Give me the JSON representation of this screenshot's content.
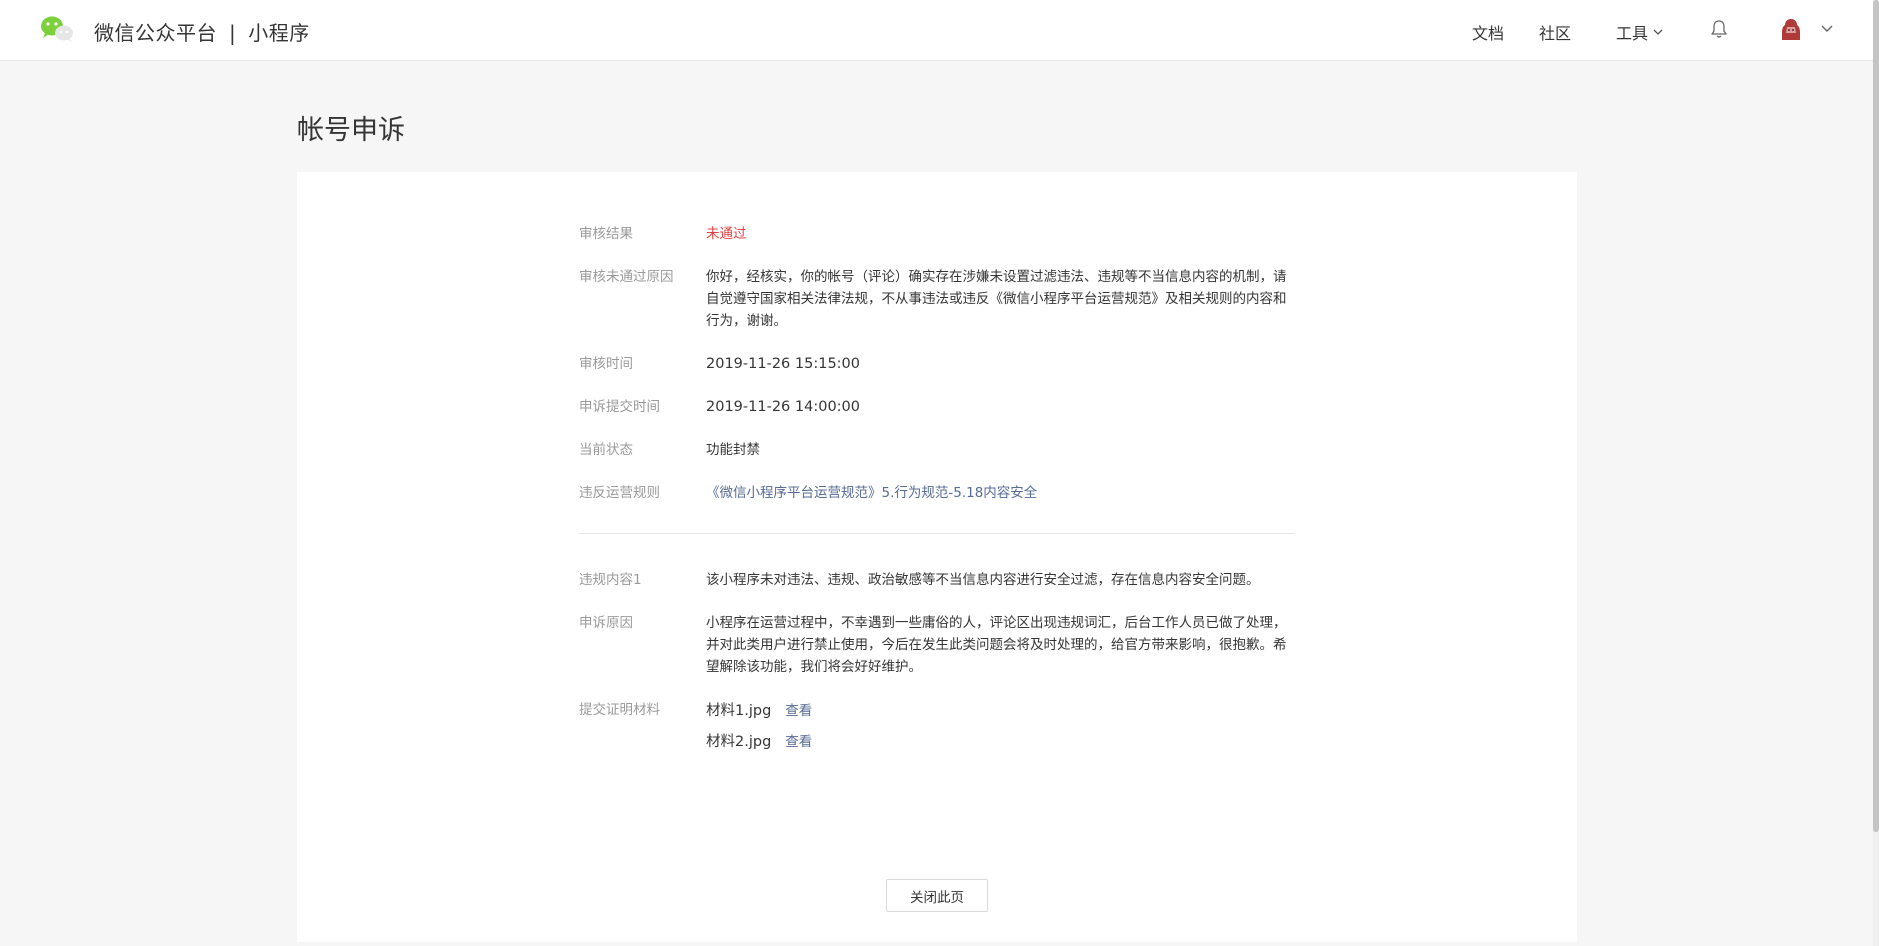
{
  "header": {
    "brand_main": "微信公众平台",
    "brand_sep": "|",
    "brand_sub": "小程序",
    "nav_docs": "文档",
    "nav_community": "社区",
    "nav_tools": "工具",
    "logo_icon": "wechat-logo-icon",
    "bell_icon": "bell-icon",
    "avatar_icon": "user-avatar"
  },
  "page": {
    "title": "帐号申诉"
  },
  "details": {
    "result_label": "审核结果",
    "result_value": "未通过",
    "reason_label": "审核未通过原因",
    "reason_value": "你好，经核实，你的帐号（评论）确实存在涉嫌未设置过滤违法、违规等不当信息内容的机制，请自觉遵守国家相关法律法规，不从事违法或违反《微信小程序平台运营规范》及相关规则的内容和行为，谢谢。",
    "review_time_label": "审核时间",
    "review_time_value": "2019-11-26 15:15:00",
    "submit_time_label": "申诉提交时间",
    "submit_time_value": "2019-11-26 14:00:00",
    "status_label": "当前状态",
    "status_value": "功能封禁",
    "rule_label": "违反运营规则",
    "rule_value": "《微信小程序平台运营规范》5.行为规范-5.18内容安全",
    "violation_label": "违规内容1",
    "violation_value": "该小程序未对违法、违规、政治敏感等不当信息内容进行安全过滤，存在信息内容安全问题。",
    "appeal_label": "申诉原因",
    "appeal_value": "小程序在运营过程中，不幸遇到一些庸俗的人，评论区出现违规词汇，后台工作人员已做了处理，并对此类用户进行禁止使用，今后在发生此类问题会将及时处理的，给官方带来影响，很抱歉。希望解除该功能，我们将会好好维护。",
    "materials_label": "提交证明材料",
    "materials": [
      {
        "name": "材料1.jpg",
        "action": "查看"
      },
      {
        "name": "材料2.jpg",
        "action": "查看"
      }
    ]
  },
  "footer": {
    "close_label": "关闭此页"
  },
  "colors": {
    "accent_red": "#e64340",
    "link_blue": "#576b95",
    "wechat_green": "#7bd03c"
  }
}
